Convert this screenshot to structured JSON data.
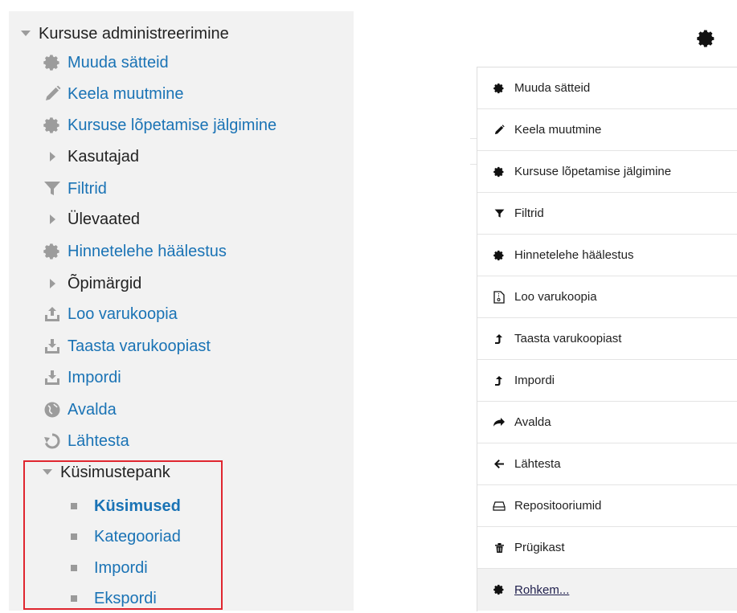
{
  "admin_tree": {
    "title": "Kursuse administreerimine",
    "items": [
      {
        "label": "Muuda sätteid",
        "icon": "gear-icon"
      },
      {
        "label": "Keela muutmine",
        "icon": "pencil-icon"
      },
      {
        "label": "Kursuse lõpetamise jälgimine",
        "icon": "gear-icon"
      },
      {
        "label": "Kasutajad",
        "icon": "caret-right-icon"
      },
      {
        "label": "Filtrid",
        "icon": "filter-icon"
      },
      {
        "label": "Ülevaated",
        "icon": "caret-right-icon"
      },
      {
        "label": "Hinnetelehe häälestus",
        "icon": "gear-icon"
      },
      {
        "label": "Õpimärgid",
        "icon": "caret-right-icon"
      },
      {
        "label": "Loo varukoopia",
        "icon": "upload-icon"
      },
      {
        "label": "Taasta varukoopiast",
        "icon": "download-icon"
      },
      {
        "label": "Impordi",
        "icon": "download-icon"
      },
      {
        "label": "Avalda",
        "icon": "globe-icon"
      },
      {
        "label": "Lähtesta",
        "icon": "reset-icon"
      }
    ],
    "question_bank": {
      "title": "Küsimustepank",
      "items": [
        "Küsimused",
        "Kategooriad",
        "Impordi",
        "Ekspordi"
      ]
    }
  },
  "actions_menu": {
    "trigger_icon": "gear-icon",
    "items": [
      {
        "label": "Muuda sätteid",
        "icon": "gear-icon"
      },
      {
        "label": "Keela muutmine",
        "icon": "pencil-icon"
      },
      {
        "label": "Kursuse lõpetamise jälgimine",
        "icon": "gear-icon"
      },
      {
        "label": "Filtrid",
        "icon": "filter-icon"
      },
      {
        "label": "Hinnetelehe häälestus",
        "icon": "gear-icon"
      },
      {
        "label": "Loo varukoopia",
        "icon": "file-archive-icon"
      },
      {
        "label": "Taasta varukoopiast",
        "icon": "level-up-icon"
      },
      {
        "label": "Impordi",
        "icon": "level-up-icon"
      },
      {
        "label": "Avalda",
        "icon": "share-arrow-icon"
      },
      {
        "label": "Lähtesta",
        "icon": "arrow-left-icon"
      },
      {
        "label": "Repositooriumid",
        "icon": "hdd-icon"
      },
      {
        "label": "Prügikast",
        "icon": "trash-icon"
      },
      {
        "label": "Rohkem...",
        "icon": "gear-icon"
      }
    ]
  },
  "colors": {
    "link": "#1a73b5",
    "highlight_box": "#e0262f",
    "tree_bg": "#f2f2f2"
  }
}
